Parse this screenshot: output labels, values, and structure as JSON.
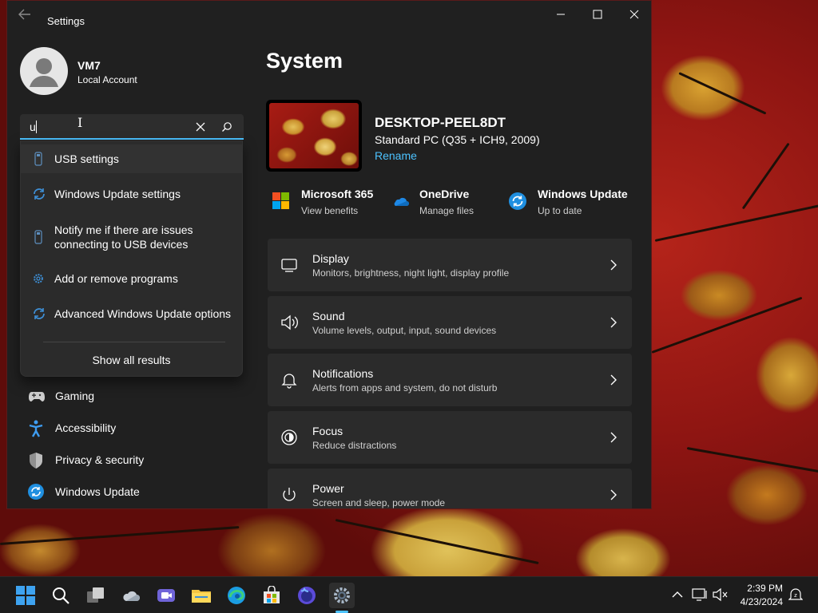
{
  "window": {
    "app_title": "Settings"
  },
  "user": {
    "name": "VM7",
    "account_type": "Local Account"
  },
  "search": {
    "value": "u",
    "suggestions": [
      {
        "label": "USB settings",
        "icon": "usb-icon"
      },
      {
        "label": "Windows Update settings",
        "icon": "refresh-icon"
      },
      {
        "label": "Notify me if there are issues",
        "label2": "connecting to USB devices",
        "icon": "usb-icon"
      },
      {
        "label": "Add or remove programs",
        "icon": "gear-icon"
      },
      {
        "label": "Advanced Windows Update options",
        "icon": "refresh-icon"
      }
    ],
    "show_all": "Show all results"
  },
  "nav": {
    "items": [
      {
        "label": "Gaming",
        "icon": "gamepad-icon"
      },
      {
        "label": "Accessibility",
        "icon": "accessibility-icon"
      },
      {
        "label": "Privacy & security",
        "icon": "shield-icon"
      },
      {
        "label": "Windows Update",
        "icon": "windows-update-icon"
      }
    ]
  },
  "main": {
    "title": "System",
    "device": {
      "name": "DESKTOP-PEEL8DT",
      "model": "Standard PC (Q35 + ICH9, 2009)",
      "rename": "Rename"
    },
    "quick_links": [
      {
        "title": "Microsoft 365",
        "subtitle": "View benefits",
        "icon": "microsoft-365-icon"
      },
      {
        "title": "OneDrive",
        "subtitle": "Manage files",
        "icon": "onedrive-icon"
      },
      {
        "title": "Windows Update",
        "subtitle": "Up to date",
        "icon": "windows-update-icon"
      }
    ],
    "cards": [
      {
        "title": "Display",
        "subtitle": "Monitors, brightness, night light, display profile",
        "icon": "monitor-icon"
      },
      {
        "title": "Sound",
        "subtitle": "Volume levels, output, input, sound devices",
        "icon": "speaker-icon"
      },
      {
        "title": "Notifications",
        "subtitle": "Alerts from apps and system, do not disturb",
        "icon": "bell-icon"
      },
      {
        "title": "Focus",
        "subtitle": "Reduce distractions",
        "icon": "focus-icon"
      },
      {
        "title": "Power",
        "subtitle": "Screen and sleep, power mode",
        "icon": "power-icon"
      }
    ]
  },
  "taskbar": {
    "time": "2:39 PM",
    "date": "4/23/2024"
  },
  "colors": {
    "accent": "#4cc2ff",
    "window_bg": "#202020",
    "card_bg": "#2b2b2b"
  }
}
